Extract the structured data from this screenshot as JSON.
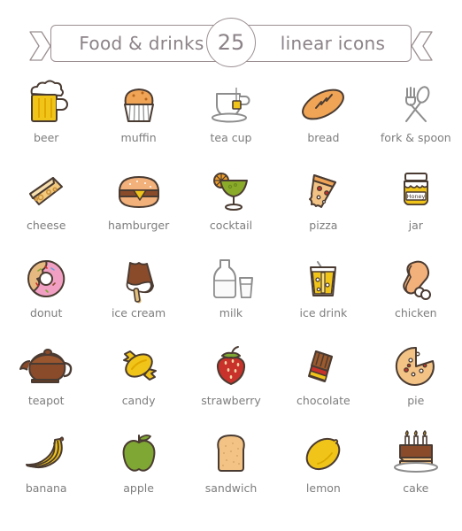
{
  "banner": {
    "left_text": "Food & drinks",
    "count": "25",
    "right_text": "linear icons"
  },
  "colors": {
    "outline": "#4a3b32",
    "caption": "#7d7d7d",
    "ribbon_stroke": "#9b8f91",
    "ribbon_text": "#8b8287",
    "gold": "#f0c419",
    "amber": "#e8a33d",
    "orange_light": "#f2b07a",
    "orange": "#efa456",
    "brown": "#8a4b2a",
    "brown_dark": "#6b3a1f",
    "chocolate": "#9c5a2d",
    "red": "#c8322b",
    "pink": "#f1a0c4",
    "green": "#8aab2a",
    "green_apple": "#7fa733",
    "gray_outline": "#8d8d8d",
    "white": "#ffffff",
    "cream": "#f5d9a8",
    "tan": "#e6b980"
  },
  "icons": [
    {
      "label": "beer",
      "name": "beer-mug-icon"
    },
    {
      "label": "muffin",
      "name": "muffin-icon"
    },
    {
      "label": "tea cup",
      "name": "tea-cup-icon"
    },
    {
      "label": "bread",
      "name": "bread-loaf-icon"
    },
    {
      "label": "fork & spoon",
      "name": "fork-and-spoon-icon"
    },
    {
      "label": "cheese",
      "name": "cheese-wedge-icon"
    },
    {
      "label": "hamburger",
      "name": "hamburger-icon"
    },
    {
      "label": "cocktail",
      "name": "cocktail-glass-icon"
    },
    {
      "label": "pizza",
      "name": "pizza-slice-icon"
    },
    {
      "label": "jar",
      "name": "honey-jar-icon",
      "jar_label": "Honey"
    },
    {
      "label": "donut",
      "name": "donut-icon"
    },
    {
      "label": "ice cream",
      "name": "ice-cream-bar-icon"
    },
    {
      "label": "milk",
      "name": "milk-bottle-icon"
    },
    {
      "label": "ice drink",
      "name": "ice-drink-icon"
    },
    {
      "label": "chicken",
      "name": "chicken-drumstick-icon"
    },
    {
      "label": "teapot",
      "name": "teapot-icon"
    },
    {
      "label": "candy",
      "name": "candy-icon"
    },
    {
      "label": "strawberry",
      "name": "strawberry-icon"
    },
    {
      "label": "chocolate",
      "name": "chocolate-bar-icon"
    },
    {
      "label": "pie",
      "name": "pie-icon"
    },
    {
      "label": "banana",
      "name": "banana-icon"
    },
    {
      "label": "apple",
      "name": "apple-icon"
    },
    {
      "label": "sandwich",
      "name": "sandwich-bread-slice-icon"
    },
    {
      "label": "lemon",
      "name": "lemon-icon"
    },
    {
      "label": "cake",
      "name": "birthday-cake-icon"
    }
  ]
}
